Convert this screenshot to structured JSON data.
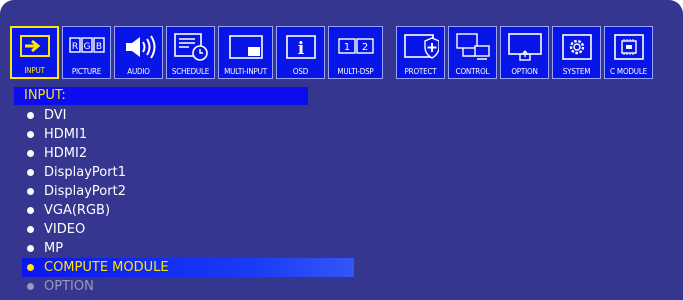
{
  "toolbar": {
    "left": [
      {
        "label": "INPUT",
        "icon": "input-icon",
        "active": true
      },
      {
        "label": "PICTURE",
        "icon": "picture-icon"
      },
      {
        "label": "AUDIO",
        "icon": "audio-icon"
      },
      {
        "label": "SCHEDULE",
        "icon": "schedule-icon"
      },
      {
        "label": "MULTI-INPUT",
        "icon": "multi-input-icon"
      },
      {
        "label": "OSD",
        "icon": "osd-icon"
      },
      {
        "label": "MULTI-DSP",
        "icon": "multi-dsp-icon",
        "text": [
          "1",
          "2"
        ]
      }
    ],
    "right": [
      {
        "label": "PROTECT",
        "icon": "protect-icon"
      },
      {
        "label": "CONTROL",
        "icon": "control-icon"
      },
      {
        "label": "OPTION",
        "icon": "option-icon"
      },
      {
        "label": "SYSTEM",
        "icon": "system-icon"
      },
      {
        "label": "C MODULE",
        "icon": "c-module-icon"
      }
    ],
    "picture_letters": [
      "R",
      "G",
      "B"
    ],
    "osd_letter": "i"
  },
  "menu": {
    "title": "INPUT:",
    "items": [
      {
        "label": "DVI",
        "state": "normal"
      },
      {
        "label": "HDMI1",
        "state": "normal"
      },
      {
        "label": "HDMI2",
        "state": "normal"
      },
      {
        "label": "DisplayPort1",
        "state": "normal"
      },
      {
        "label": "DisplayPort2",
        "state": "normal"
      },
      {
        "label": "VGA(RGB)",
        "state": "normal"
      },
      {
        "label": "VIDEO",
        "state": "normal"
      },
      {
        "label": "MP",
        "state": "normal"
      },
      {
        "label": "COMPUTE MODULE",
        "state": "selected"
      },
      {
        "label": "OPTION",
        "state": "disabled"
      }
    ]
  },
  "colors": {
    "background": "#34368f",
    "toolbar_button": "#0716e6",
    "highlight": "#ffe600",
    "text": "#ffffff",
    "disabled": "#9a9ab8"
  }
}
